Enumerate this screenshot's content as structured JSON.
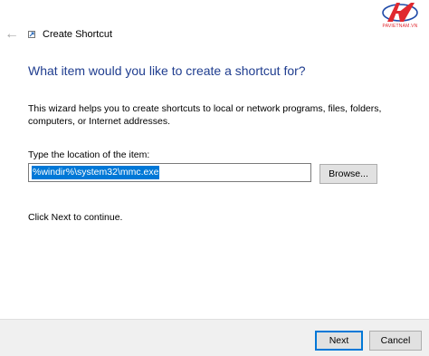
{
  "window": {
    "title": "Create Shortcut",
    "back_icon": "back-arrow-icon",
    "app_icon": "shortcut-icon"
  },
  "logo": {
    "text": "PAVIETNAM.VN",
    "colors": {
      "red": "#e0282f",
      "blue": "#1f4aa8"
    }
  },
  "wizard": {
    "heading": "What item would you like to create a shortcut for?",
    "description": "This wizard helps you to create shortcuts to local or network programs, files, folders, computers, or Internet addresses.",
    "location_label": "Type the location of the item:",
    "location_value": "%windir%\\system32\\mmc.exe",
    "browse_label": "Browse...",
    "continue_text": "Click Next to continue."
  },
  "footer": {
    "next_label": "Next",
    "cancel_label": "Cancel"
  },
  "colors": {
    "heading": "#1f3d8f",
    "selection": "#0078d7",
    "default_button_border": "#0078d7"
  }
}
